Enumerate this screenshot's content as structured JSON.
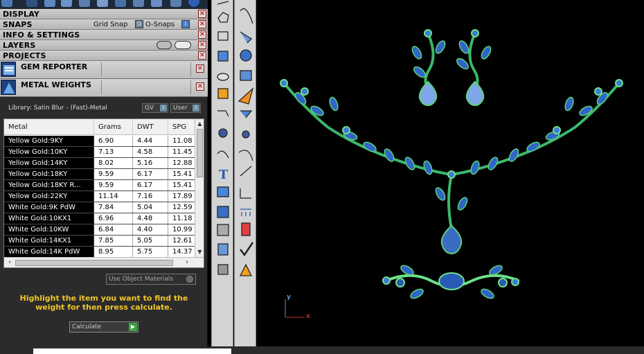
{
  "sections": {
    "display": "DISPLAY",
    "snaps": "SNAPS",
    "grid_snap": "Grid Snap",
    "o_snaps": "O-Snaps",
    "info_settings": "INFO & SETTINGS",
    "layers": "LAYERS",
    "projects": "PROJECTS"
  },
  "plugins": {
    "gem_reporter": "GEM REPORTER",
    "metal_weights": "METAL WEIGHTS"
  },
  "library": {
    "label": "Library: Satin Blur - (Fast)-Metal",
    "gv": "GV",
    "user": "User"
  },
  "table": {
    "headers": [
      "Metal",
      "Grams",
      "DWT",
      "SPG"
    ],
    "rows": [
      [
        "Yellow Gold:9KY",
        "6.90",
        "4.44",
        "11.08"
      ],
      [
        "Yellow Gold:10KY",
        "7.13",
        "4.58",
        "11.45"
      ],
      [
        "Yellow Gold:14KY",
        "8.02",
        "5.16",
        "12.88"
      ],
      [
        "Yellow Gold:18KY",
        "9.59",
        "6.17",
        "15.41"
      ],
      [
        "Yellow Gold:18KY R...",
        "9.59",
        "6.17",
        "15.41"
      ],
      [
        "Yellow Gold:22KY",
        "11.14",
        "7.16",
        "17.89"
      ],
      [
        "White Gold:9K PdW",
        "7.84",
        "5.04",
        "12.59"
      ],
      [
        "White Gold:10KX1",
        "6.96",
        "4.48",
        "11.18"
      ],
      [
        "White Gold:10KW",
        "6.84",
        "4.40",
        "10.99"
      ],
      [
        "White Gold:14KX1",
        "7.85",
        "5.05",
        "12.61"
      ],
      [
        "White Gold:14K PdW",
        "8.95",
        "5.75",
        "14.37"
      ]
    ]
  },
  "use_object_materials": "Use Object Materials",
  "hint": "Highlight the item you want to find the weight for then press calculate.",
  "calculate": "Calculate",
  "axis": {
    "y": "y",
    "x": "x"
  },
  "colors": {
    "accent_yellow": "#f0c62a",
    "panel_bg": "#2b2b2b",
    "stem_green": "#3ea85a",
    "gem_blue": "#3f6fc4"
  }
}
